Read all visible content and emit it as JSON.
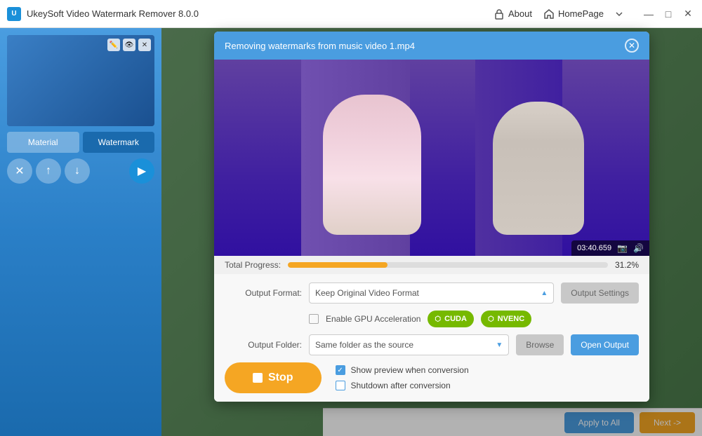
{
  "app": {
    "title": "UkeySoft Video Watermark Remover 8.0.0",
    "logo_letter": "U"
  },
  "titlebar": {
    "about_label": "About",
    "homepage_label": "HomePage",
    "minimize": "—",
    "maximize": "□",
    "close": "✕"
  },
  "sidebar": {
    "tab_material": "Material",
    "tab_watermark": "Watermark",
    "delete_btn": "✕",
    "up_btn": "↑",
    "down_btn": "↓",
    "play_btn": "▶"
  },
  "modal": {
    "title": "Removing watermarks from music video 1.mp4",
    "close": "✕",
    "progress_label": "Total Progress:",
    "progress_percent": "31.2%",
    "progress_value": 31.2
  },
  "controls": {
    "output_format_label": "Output Format:",
    "output_format_value": "Keep Original Video Format",
    "output_settings_label": "Output Settings",
    "gpu_acceleration_label": "Enable GPU Acceleration",
    "cuda_label": "CUDA",
    "nvenc_label": "NVENC",
    "output_folder_label": "Output Folder:",
    "output_folder_value": "Same folder as the source",
    "browse_label": "Browse",
    "open_output_label": "Open Output",
    "stop_label": "Stop",
    "show_preview_label": "Show preview when conversion",
    "shutdown_label": "Shutdown after conversion"
  },
  "bottom_bar": {
    "apply_all_label": "Apply to All",
    "next_label": "Next ->"
  },
  "video_time": "03:40.659"
}
